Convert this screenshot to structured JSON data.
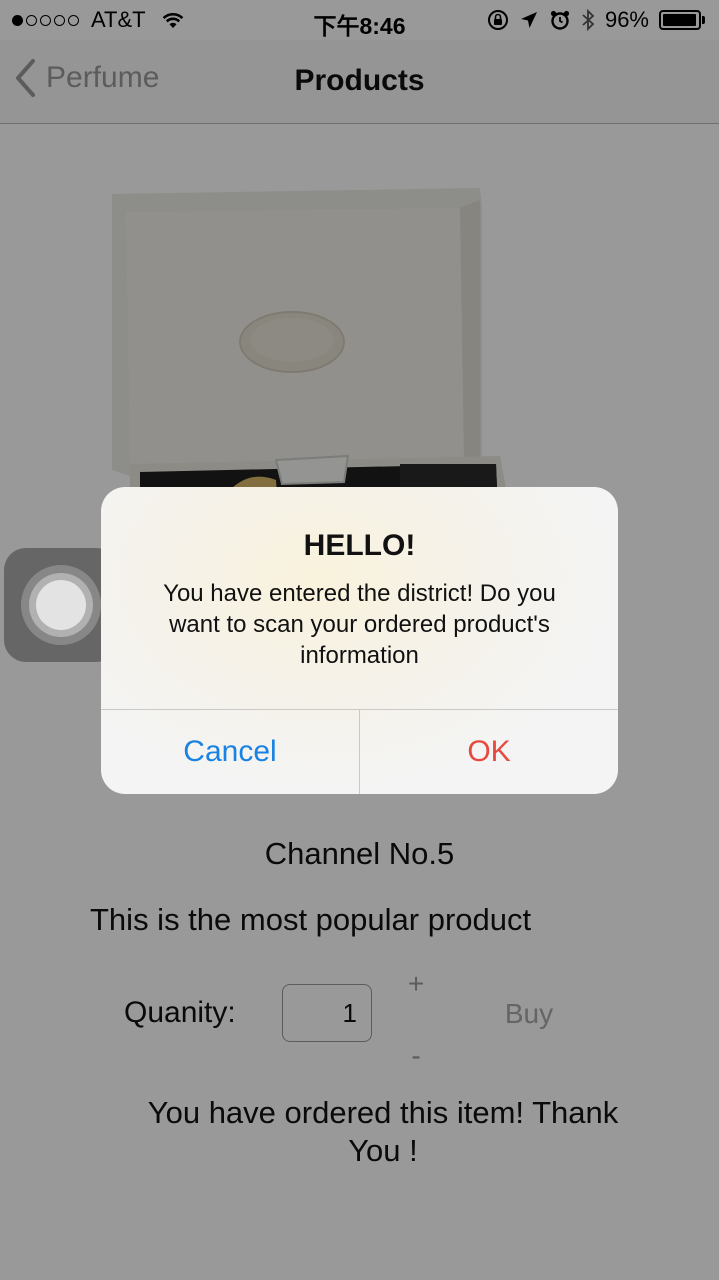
{
  "status_bar": {
    "carrier": "AT&T",
    "time": "下午8:46",
    "battery_percent_label": "96%",
    "battery_level": 0.96,
    "signal_bars_filled": 1,
    "signal_bars_total": 5
  },
  "nav_bar": {
    "back_label": "Perfume",
    "title": "Products"
  },
  "product": {
    "name": "Channel No.5",
    "description": "This is the most popular product"
  },
  "quantity": {
    "label": "Quanity:",
    "value": "1",
    "increment_label": "+",
    "decrement_label": "-"
  },
  "buy_label": "Buy",
  "order_message": "You have ordered this item! Thank You !",
  "alert": {
    "title": "HELLO!",
    "message": "You have entered the district! Do you want to scan your ordered product's information",
    "cancel_label": "Cancel",
    "ok_label": "OK"
  },
  "colors": {
    "cancel_button": "#1a82e2",
    "ok_button": "#e8483e",
    "dim_overlay": "rgba(0,0,0,0.4)"
  },
  "icons": {
    "wifi": "wifi-icon",
    "orientation_lock": "orientation-lock-icon",
    "location": "location-arrow-icon",
    "alarm": "alarm-icon",
    "bluetooth": "bluetooth-icon",
    "battery": "battery-icon",
    "back": "chevron-left-icon",
    "assistive_touch": "assistive-touch-icon"
  }
}
